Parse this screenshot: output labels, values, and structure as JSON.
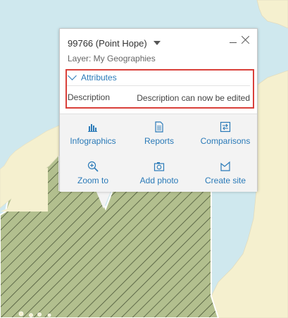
{
  "popup": {
    "title": "99766 (Point Hope)",
    "layer_line": "Layer: My Geographies",
    "attributes_label": "Attributes",
    "description_key": "Description",
    "description_value": "Description can now be edited"
  },
  "actions": [
    {
      "label": "Infographics",
      "icon": "bar-chart-icon"
    },
    {
      "label": "Reports",
      "icon": "document-icon"
    },
    {
      "label": "Comparisons",
      "icon": "compare-icon"
    },
    {
      "label": "Zoom to",
      "icon": "zoom-in-icon"
    },
    {
      "label": "Add photo",
      "icon": "camera-icon"
    },
    {
      "label": "Create site",
      "icon": "flag-icon"
    }
  ],
  "colors": {
    "water": "#cfe8ee",
    "land": "#f5f0cf",
    "selected_area": "#b2bf8e",
    "hatch": "#3f4a2e",
    "link": "#2a7ab8",
    "highlight_border": "#d9403a"
  }
}
